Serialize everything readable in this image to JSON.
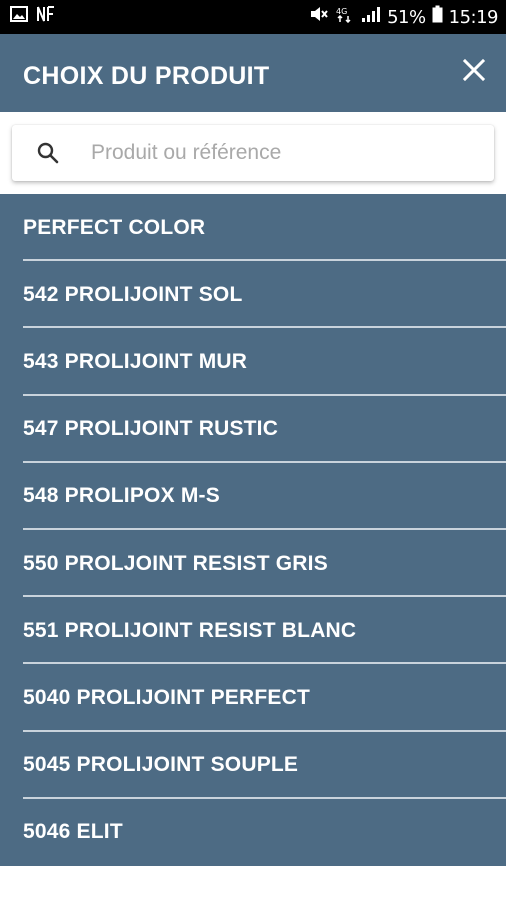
{
  "status_bar": {
    "left_icons": [
      "image-icon",
      "nfc-icon"
    ],
    "right_icons": [
      "mute-icon",
      "lte-icon",
      "signal-icon"
    ],
    "battery_percent": "51%",
    "battery_icon": "battery-icon",
    "time": "15:19"
  },
  "header": {
    "title": "CHOIX DU PRODUIT",
    "close_icon": "close-icon"
  },
  "search": {
    "placeholder": "Produit ou référence",
    "value": "",
    "icon": "search-icon"
  },
  "products": [
    {
      "label": "PERFECT COLOR"
    },
    {
      "label": "542 PROLIJOINT SOL"
    },
    {
      "label": "543 PROLIJOINT MUR"
    },
    {
      "label": "547 PROLIJOINT RUSTIC"
    },
    {
      "label": "548 PROLIPOX M-S"
    },
    {
      "label": "550 PROLJOINT RESIST GRIS"
    },
    {
      "label": "551 PROLIJOINT RESIST BLANC"
    },
    {
      "label": "5040 PROLIJOINT PERFECT"
    },
    {
      "label": "5045 PROLIJOINT SOUPLE"
    },
    {
      "label": "5046 ELIT"
    }
  ],
  "colors": {
    "primary": "#4d6b84",
    "divider": "#c9d3dc",
    "status_bar": "#000000"
  }
}
